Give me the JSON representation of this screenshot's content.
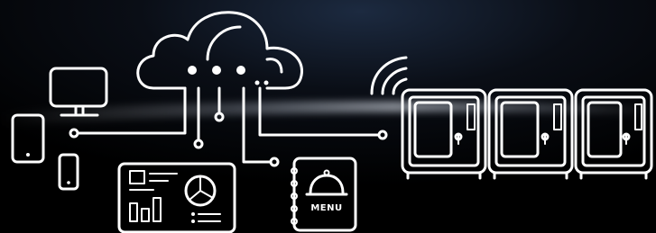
{
  "illustration": {
    "menu_label": "MENU"
  },
  "colors": {
    "background": "#000000",
    "stroke": "#ffffff",
    "light_streak": "#cfd8e6"
  },
  "icons": [
    "cloud-icon",
    "wifi-icon",
    "monitor-icon",
    "tablet-icon",
    "smartphone-icon",
    "dashboard-icon",
    "menu-book-icon",
    "oven-icon"
  ]
}
